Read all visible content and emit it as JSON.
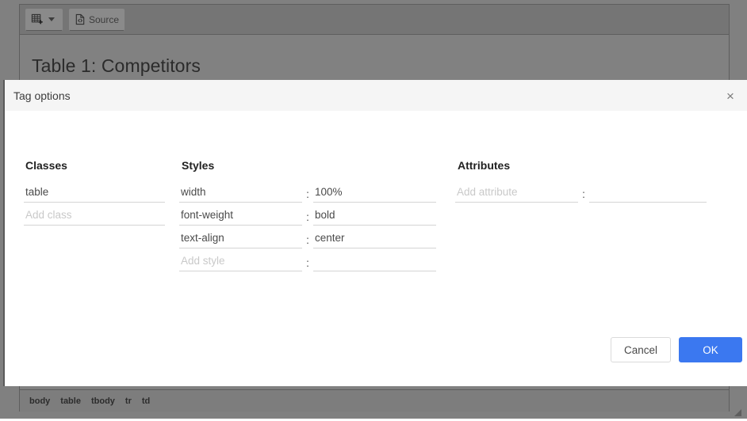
{
  "editor": {
    "toolbar": {
      "insert_table_button": {
        "icon": "table-insert-icon",
        "dropdown_icon": "chevron-down-icon"
      },
      "source_button": {
        "label": "Source",
        "icon": "source-code-icon"
      }
    },
    "document": {
      "heading": "Table 1: Competitors"
    },
    "element_path": [
      "body",
      "table",
      "tbody",
      "tr",
      "td"
    ],
    "resize_grip_icon": "resize-handle-icon"
  },
  "dialog": {
    "title": "Tag options",
    "close_icon": "close-icon",
    "columns": {
      "classes": {
        "heading": "Classes",
        "rows": [
          {
            "value": "table",
            "placeholder": ""
          },
          {
            "value": "",
            "placeholder": "Add class"
          }
        ]
      },
      "styles": {
        "heading": "Styles",
        "separator": ":",
        "rows": [
          {
            "key": "width",
            "key_placeholder": "",
            "value": "100%",
            "value_placeholder": ""
          },
          {
            "key": "font-weight",
            "key_placeholder": "",
            "value": "bold",
            "value_placeholder": ""
          },
          {
            "key": "text-align",
            "key_placeholder": "",
            "value": "center",
            "value_placeholder": ""
          },
          {
            "key": "",
            "key_placeholder": "Add style",
            "value": "",
            "value_placeholder": ""
          }
        ]
      },
      "attributes": {
        "heading": "Attributes",
        "separator": ":",
        "rows": [
          {
            "key": "",
            "key_placeholder": "Add attribute",
            "value": "",
            "value_placeholder": ""
          }
        ]
      }
    },
    "footer": {
      "cancel_label": "Cancel",
      "ok_label": "OK"
    }
  },
  "colors": {
    "accent": "#3b78f0",
    "dialog_header": "#f5f5f5",
    "backdrop": "#808080",
    "underline": "#d4d4d4"
  }
}
